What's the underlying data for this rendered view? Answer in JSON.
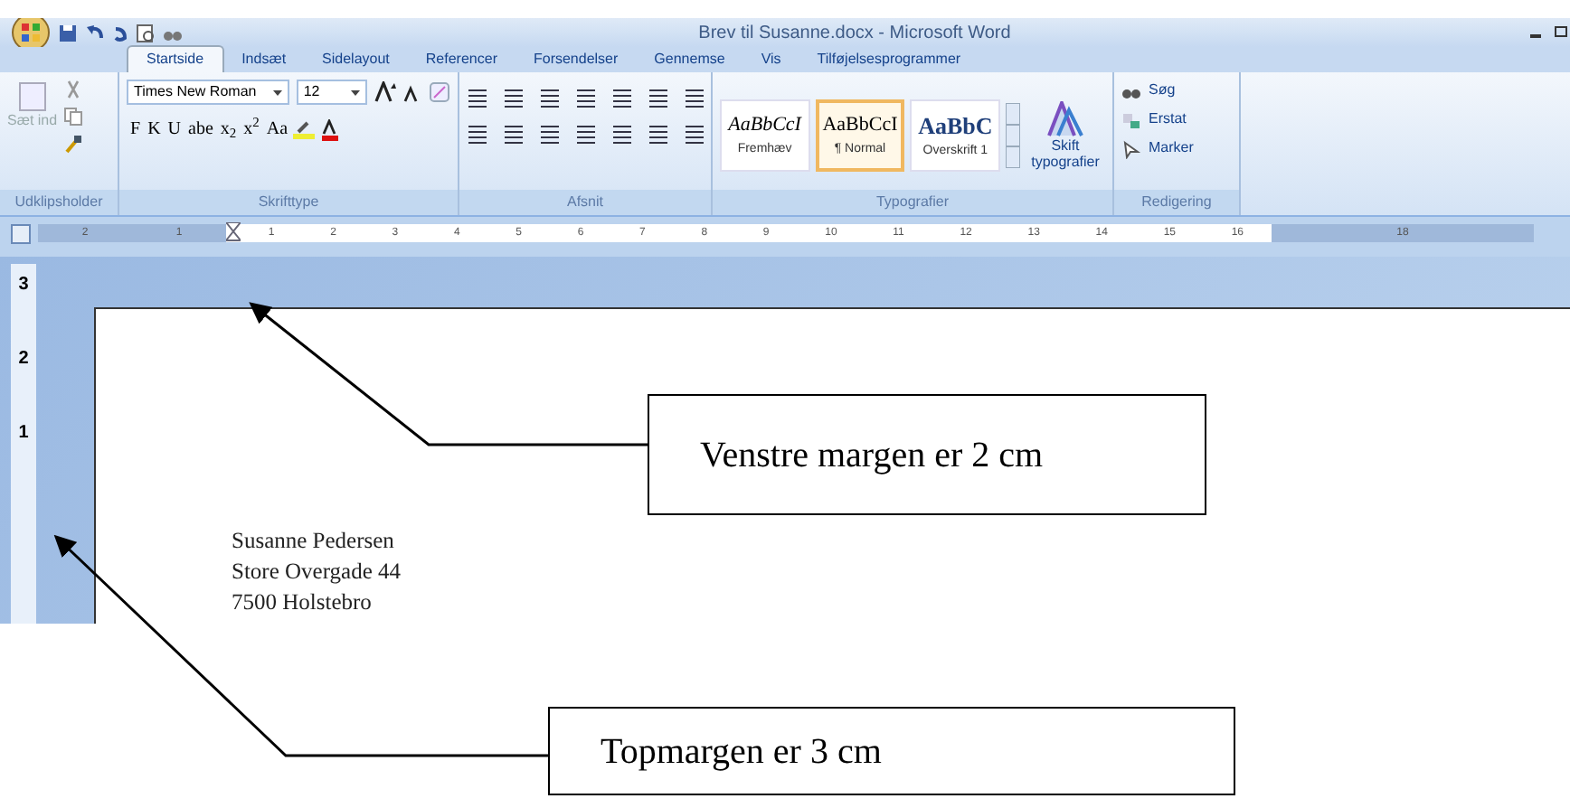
{
  "window": {
    "title": "Brev til Susanne.docx - Microsoft Word"
  },
  "tabs": [
    {
      "label": "Startside",
      "selected": true
    },
    {
      "label": "Indsæt",
      "selected": false
    },
    {
      "label": "Sidelayout",
      "selected": false
    },
    {
      "label": "Referencer",
      "selected": false
    },
    {
      "label": "Forsendelser",
      "selected": false
    },
    {
      "label": "Gennemse",
      "selected": false
    },
    {
      "label": "Vis",
      "selected": false
    },
    {
      "label": "Tilføjelsesprogrammer",
      "selected": false
    }
  ],
  "ribbon": {
    "clipboard": {
      "paste_label": "Sæt ind",
      "disabled": true,
      "group_label": "Udklipsholder"
    },
    "font": {
      "name": "Times New Roman",
      "size": "12",
      "buttons": [
        "F",
        "K",
        "U",
        "abe",
        "x$_{2}$",
        "x$^{2}$",
        "Aa"
      ],
      "group_label": "Skrifttype"
    },
    "paragraph": {
      "group_label": "Afsnit"
    },
    "styles": {
      "items": [
        {
          "preview": "AaBbCcI",
          "label": "Fremhæv",
          "selected": false,
          "kind": "italic"
        },
        {
          "preview": "AaBbCcI",
          "label": "¶ Normal",
          "selected": true,
          "kind": "normal"
        },
        {
          "preview": "AaBbC",
          "label": "Overskrift 1",
          "selected": false,
          "kind": "heading"
        }
      ],
      "change_label": "Skift typografier",
      "group_label": "Typografier"
    },
    "editing": {
      "items": [
        "Søg",
        "Erstat",
        "Marker"
      ],
      "group_label": "Redigering"
    }
  },
  "ruler": {
    "left_labels": [
      "2",
      "1"
    ],
    "right_labels": [
      "1",
      "2",
      "3",
      "4",
      "5",
      "6",
      "7",
      "8",
      "9",
      "10",
      "11",
      "12",
      "13",
      "14",
      "15",
      "16"
    ],
    "end_labels": [
      "18"
    ]
  },
  "vertical_ruler": {
    "labels": [
      "3",
      "2",
      "1"
    ]
  },
  "document": {
    "lines": [
      "Susanne Pedersen",
      "Store Overgade 44",
      "7500 Holstebro"
    ]
  },
  "callouts": [
    {
      "text": "Venstre margen er 2 cm"
    },
    {
      "text": "Topmargen er 3 cm"
    }
  ]
}
